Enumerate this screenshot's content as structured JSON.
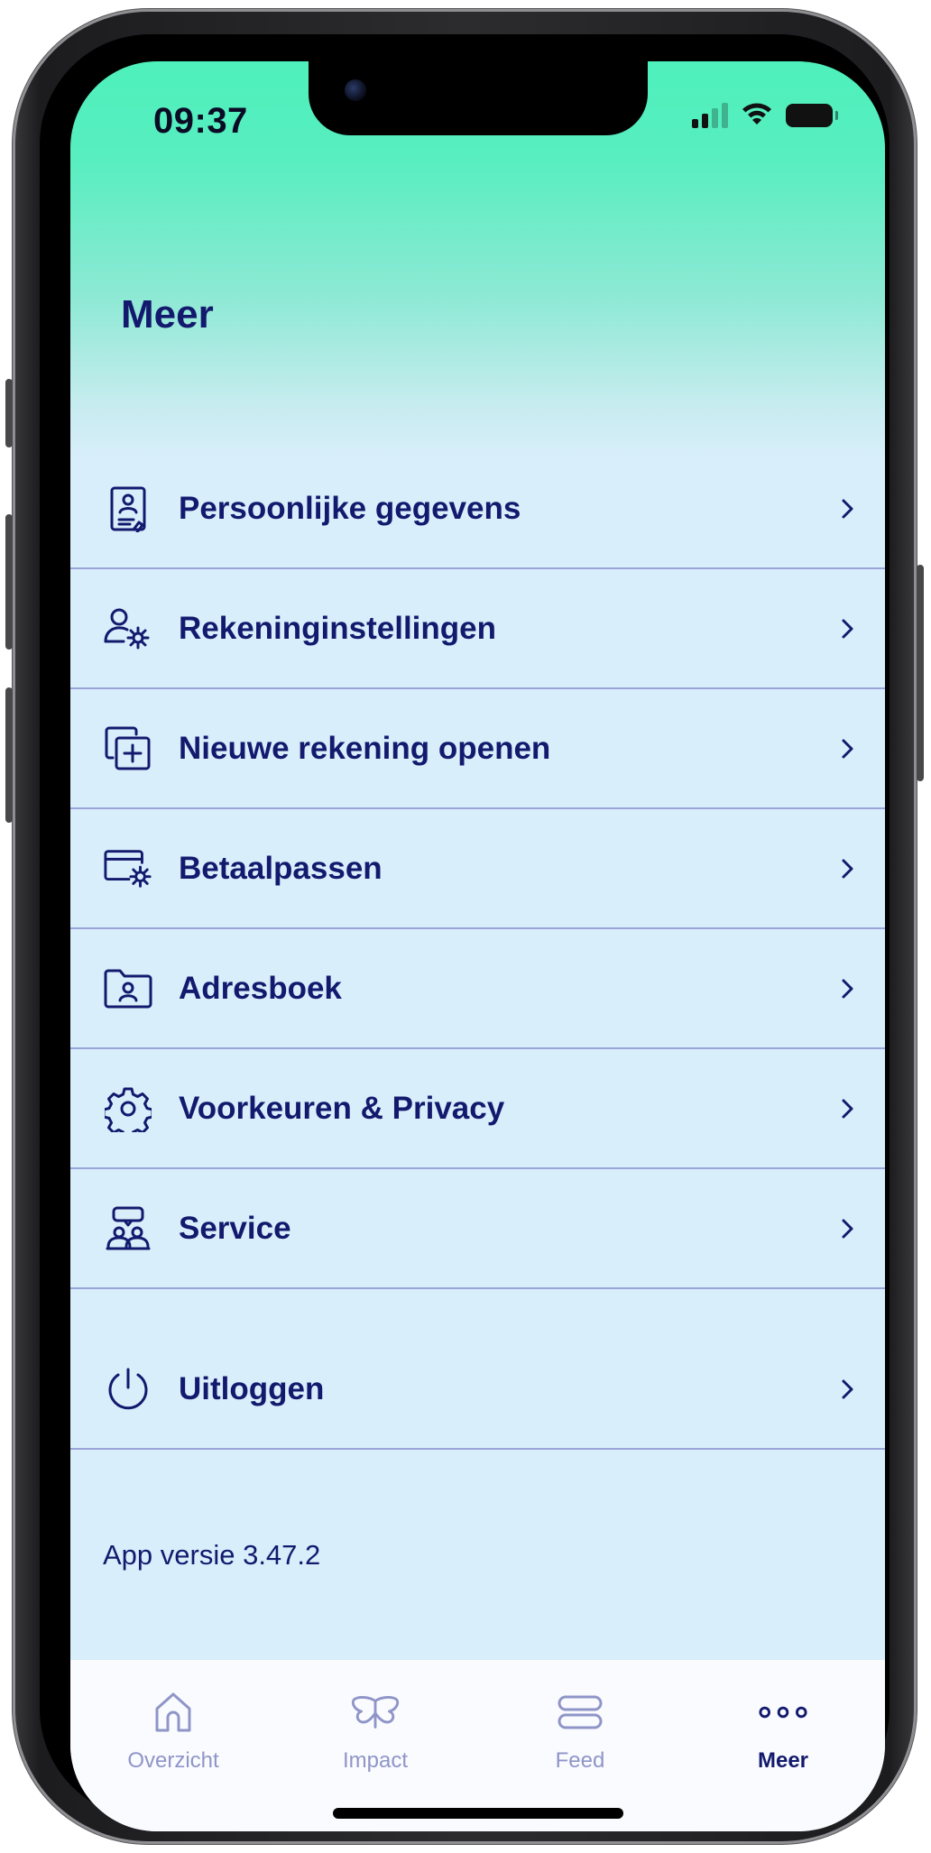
{
  "status_bar": {
    "time": "09:37"
  },
  "page": {
    "title": "Meer"
  },
  "menu": {
    "items": [
      {
        "label": "Persoonlijke gegevens",
        "icon": "id-card-icon"
      },
      {
        "label": "Rekeninginstellingen",
        "icon": "user-gear-icon"
      },
      {
        "label": "Nieuwe rekening openen",
        "icon": "add-account-icon"
      },
      {
        "label": "Betaalpassen",
        "icon": "card-gear-icon"
      },
      {
        "label": "Adresboek",
        "icon": "address-book-icon"
      },
      {
        "label": "Voorkeuren & Privacy",
        "icon": "gear-icon"
      },
      {
        "label": "Service",
        "icon": "service-icon"
      }
    ],
    "logout": {
      "label": "Uitloggen",
      "icon": "power-icon"
    }
  },
  "footer": {
    "version": "App versie 3.47.2"
  },
  "tabbar": {
    "tabs": [
      {
        "label": "Overzicht",
        "icon": "home-icon"
      },
      {
        "label": "Impact",
        "icon": "butterfly-icon"
      },
      {
        "label": "Feed",
        "icon": "feed-icon"
      },
      {
        "label": "Meer",
        "icon": "more-icon",
        "active": true
      }
    ]
  },
  "colors": {
    "primary_text": "#131a6e",
    "inactive_tab": "#8f95c8",
    "header_gradient_top": "#4ef0bb",
    "background": "#d8eefb"
  }
}
